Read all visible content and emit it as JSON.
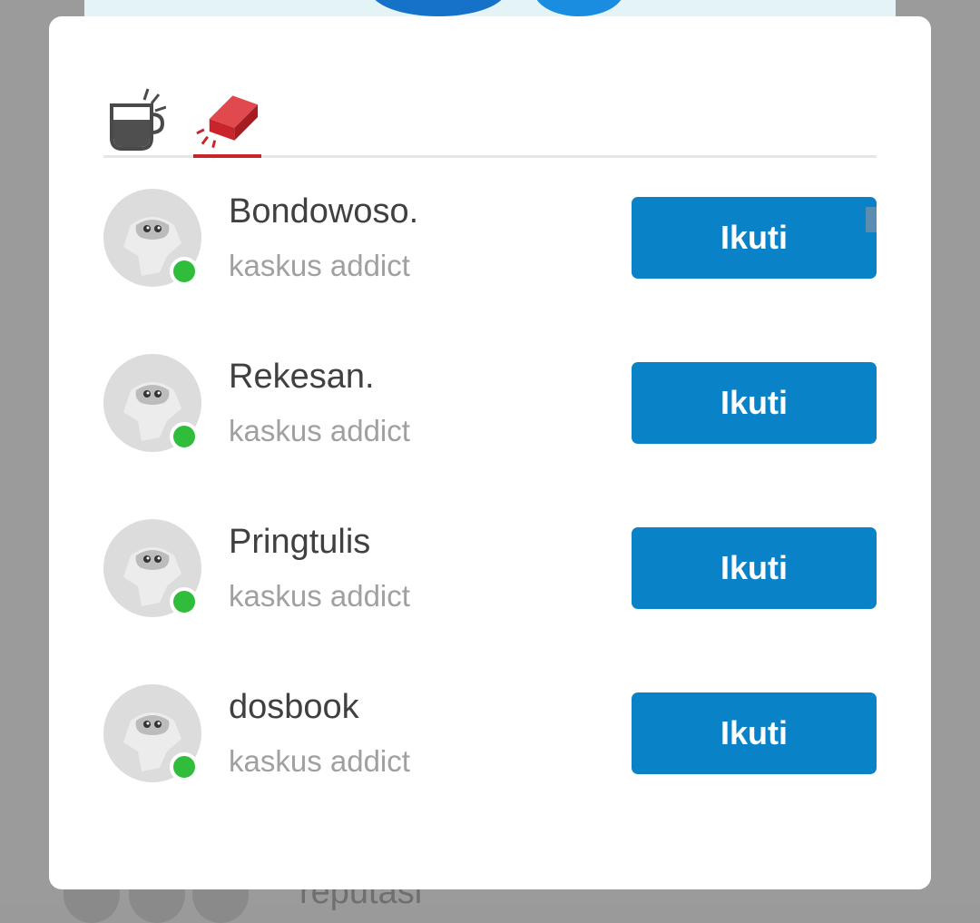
{
  "background": {
    "bottom_text": "reputasi"
  },
  "tabs": [
    {
      "icon": "cendol-cup-icon",
      "active": false
    },
    {
      "icon": "bata-brick-icon",
      "active": true
    }
  ],
  "users": [
    {
      "name": "Bondowoso.",
      "rank": "kaskus addict",
      "online": true,
      "button": "Ikuti"
    },
    {
      "name": "Rekesan.",
      "rank": "kaskus addict",
      "online": true,
      "button": "Ikuti"
    },
    {
      "name": "Pringtulis",
      "rank": "kaskus addict",
      "online": true,
      "button": "Ikuti"
    },
    {
      "name": "dosbook",
      "rank": "kaskus addict",
      "online": true,
      "button": "Ikuti"
    }
  ],
  "colors": {
    "accent": "#0a82c8",
    "active_tab": "#c9242b",
    "online": "#2fbd3b"
  }
}
